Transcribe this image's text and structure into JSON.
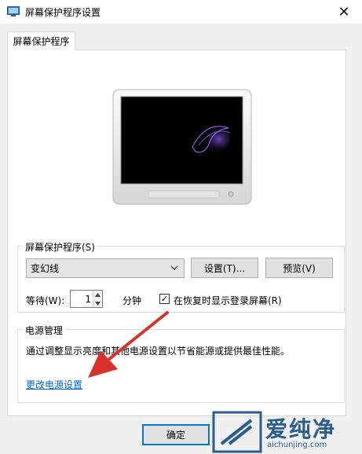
{
  "window": {
    "title": "屏幕保护程序设置",
    "close_glyph": "✕"
  },
  "tab": {
    "label": "屏幕保护程序"
  },
  "screensaver": {
    "group_label": "屏幕保护程序(S)",
    "selected": "变幻线",
    "settings_button": "设置(T)...",
    "preview_button": "预览(V)",
    "wait_label": "等待(W):",
    "wait_value": "1",
    "wait_unit": "分钟",
    "resume_checkbox_label": "在恢复时显示登录屏幕(R)",
    "resume_checked": true,
    "check_glyph": "✓"
  },
  "power": {
    "group_label": "电源管理",
    "description": "通过调整显示亮度和其他电源设置以节省能源或提供最佳性能。",
    "link_label": "更改电源设置"
  },
  "footer": {
    "ok_button": "确定"
  },
  "watermark": {
    "brand": "爱纯净",
    "url": "aichunjing.com"
  },
  "colors": {
    "accent": "#0078d7",
    "link": "#0066cc",
    "arrow": "#d9322d",
    "watermark": "#2a5d8f"
  }
}
